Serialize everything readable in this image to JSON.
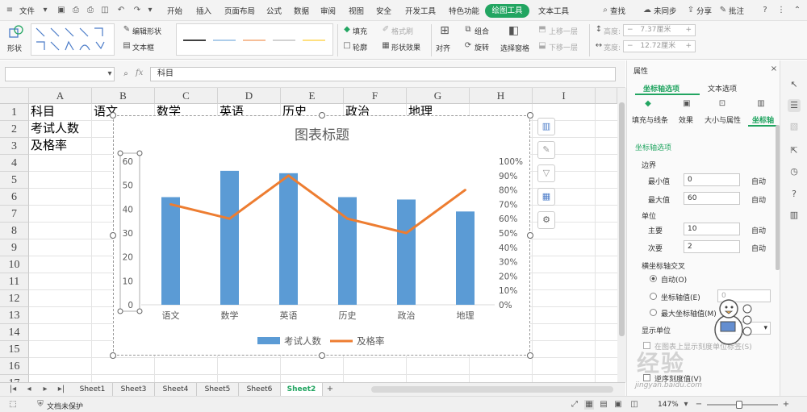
{
  "titlebar": {
    "file_label": "文件",
    "tabs": [
      "开始",
      "插入",
      "页面布局",
      "公式",
      "数据",
      "审阅",
      "视图",
      "安全",
      "开发工具",
      "特色功能",
      "绘图工具",
      "文本工具"
    ],
    "active_tab": "绘图工具",
    "search_label": "查找",
    "sync_label": "未同步",
    "share_label": "分享",
    "comment_label": "批注"
  },
  "ribbon": {
    "shape_label": "形状",
    "edit_shape_label": "编辑形状",
    "textbox_label": "文本框",
    "fill_label": "填充",
    "format_brush_label": "格式刷",
    "outline_label": "轮廓",
    "shape_effect_label": "形状效果",
    "align_label": "对齐",
    "group_label": "组合",
    "rotate_label": "旋转",
    "selection_pane_label": "选择窗格",
    "up_one_label": "上移一层",
    "down_one_label": "下移一层",
    "height_label": "高度:",
    "height_value": "7.37厘米",
    "width_label": "宽度:",
    "width_value": "12.72厘米",
    "line_colors": [
      "#000000",
      "#5b9bd5",
      "#ed7d31",
      "#a5a5a5",
      "#ffc000"
    ]
  },
  "formula": {
    "fx_label": "fx",
    "content": "科目"
  },
  "sheet": {
    "columns": [
      "A",
      "B",
      "C",
      "D",
      "E",
      "F",
      "G",
      "H",
      "I"
    ],
    "rows": [
      "1",
      "2",
      "3",
      "4",
      "5",
      "6",
      "7",
      "8",
      "9",
      "10",
      "11",
      "12",
      "13",
      "14",
      "15",
      "16",
      "17"
    ],
    "cells": {
      "A1": "科目",
      "B1": "语文",
      "C1": "数学",
      "D1": "英语",
      "E1": "历史",
      "F1": "政治",
      "G1": "地理",
      "A2": "考试人数",
      "A3": "及格率"
    },
    "tabs": [
      "Sheet1",
      "Sheet3",
      "Sheet4",
      "Sheet5",
      "Sheet6",
      "Sheet2"
    ],
    "active_tab": "Sheet2"
  },
  "chart_data": {
    "type": "bar",
    "title": "图表标题",
    "categories": [
      "语文",
      "数学",
      "英语",
      "历史",
      "政治",
      "地理"
    ],
    "series": [
      {
        "name": "考试人数",
        "type": "bar",
        "axis": "left",
        "color": "#5b9bd5",
        "values": [
          45,
          56,
          55,
          45,
          44,
          39
        ]
      },
      {
        "name": "及格率",
        "type": "line",
        "axis": "right",
        "color": "#ed7d31",
        "values": [
          0.7,
          0.6,
          0.9,
          0.6,
          0.5,
          0.8
        ]
      }
    ],
    "ylim": [
      0,
      60
    ],
    "y_ticks": [
      "0",
      "10",
      "20",
      "30",
      "40",
      "50",
      "60"
    ],
    "y2lim": [
      0,
      1
    ],
    "y2_ticks": [
      "0%",
      "10%",
      "20%",
      "30%",
      "40%",
      "50%",
      "60%",
      "70%",
      "80%",
      "90%",
      "100%"
    ],
    "grid": false,
    "legend": "bottom"
  },
  "panel": {
    "title": "属性",
    "tab_axis_options": "坐标轴选项",
    "tab_text_options": "文本选项",
    "subtabs": [
      "填充与线条",
      "效果",
      "大小与属性",
      "坐标轴"
    ],
    "active_subtab": "坐标轴",
    "section_title": "坐标轴选项",
    "bounds_label": "边界",
    "min_label": "最小值",
    "min_value": "0",
    "max_label": "最大值",
    "max_value": "60",
    "auto_label": "自动",
    "unit_label": "单位",
    "major_label": "主要",
    "major_value": "10",
    "minor_label": "次要",
    "minor_value": "2",
    "cross_label": "横坐标轴交叉",
    "cross_auto": "自动(O)",
    "cross_value_label": "坐标轴值(E)",
    "cross_value": "0",
    "cross_max": "最大坐标轴值(M)",
    "display_unit_label": "显示单位",
    "show_unit_label": "在图表上显示刻度单位标签(S)",
    "reverse_label": "逆序刻度值(V)"
  },
  "status": {
    "protect_label": "文档未保护",
    "zoom": "147%"
  },
  "watermark": {
    "text": "经验",
    "url": "jingyan.baidu.com"
  }
}
